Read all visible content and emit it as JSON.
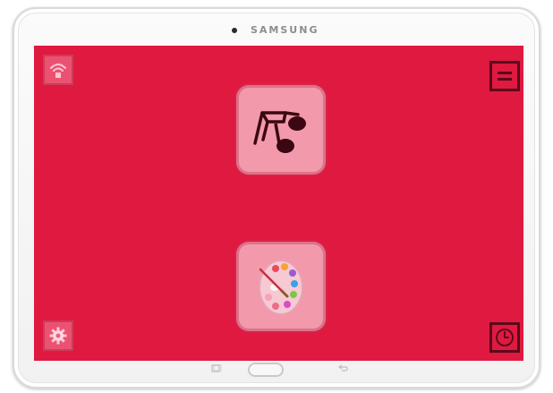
{
  "device": {
    "brand": "SAMSUNG"
  },
  "screen": {
    "background": "#e01940",
    "top_left": {
      "icon": "wifi-icon",
      "state": "faded"
    },
    "top_right": {
      "icon": "menu-icon"
    },
    "bottom_left": {
      "icon": "gear-icon",
      "state": "faded"
    },
    "bottom_right": {
      "icon": "clock-icon"
    },
    "tiles": [
      {
        "icon": "music-note-icon"
      },
      {
        "icon": "paint-palette-icon"
      }
    ]
  },
  "hardware_keys": {
    "left": "recent-apps-key",
    "center": "home-button",
    "right": "back-key"
  }
}
